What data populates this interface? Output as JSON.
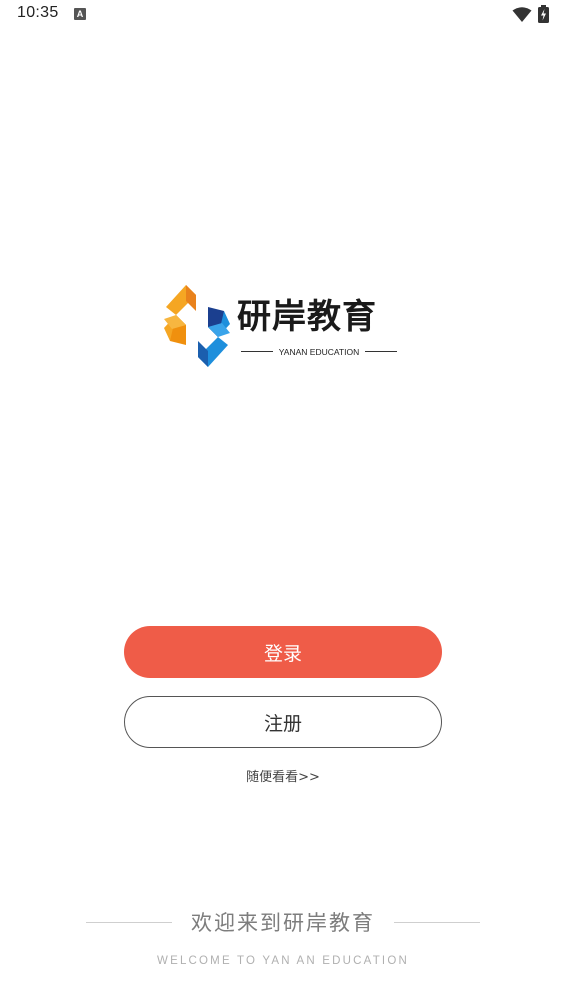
{
  "status_bar": {
    "time": "10:35",
    "notification_icon": "a-icon",
    "wifi_icon": "wifi-icon",
    "battery_icon": "battery-charging-icon"
  },
  "logo": {
    "icon": "yanan-logo-mark",
    "title": "研岸教育",
    "subtitle": "YANAN EDUCATION",
    "colors": {
      "orange": "#f5a623",
      "orange_dark": "#e9821c",
      "blue": "#1e8fdc",
      "blue_dark": "#1b3f8f"
    }
  },
  "actions": {
    "login_label": "登录",
    "register_label": "注册",
    "browse_label": "随便看看>>"
  },
  "footer": {
    "welcome": "欢迎来到研岸教育",
    "welcome_en": "WELCOME TO YAN AN EDUCATION"
  },
  "colors": {
    "accent": "#ef5c48",
    "text": "#333333",
    "muted": "#7d7d7d"
  }
}
